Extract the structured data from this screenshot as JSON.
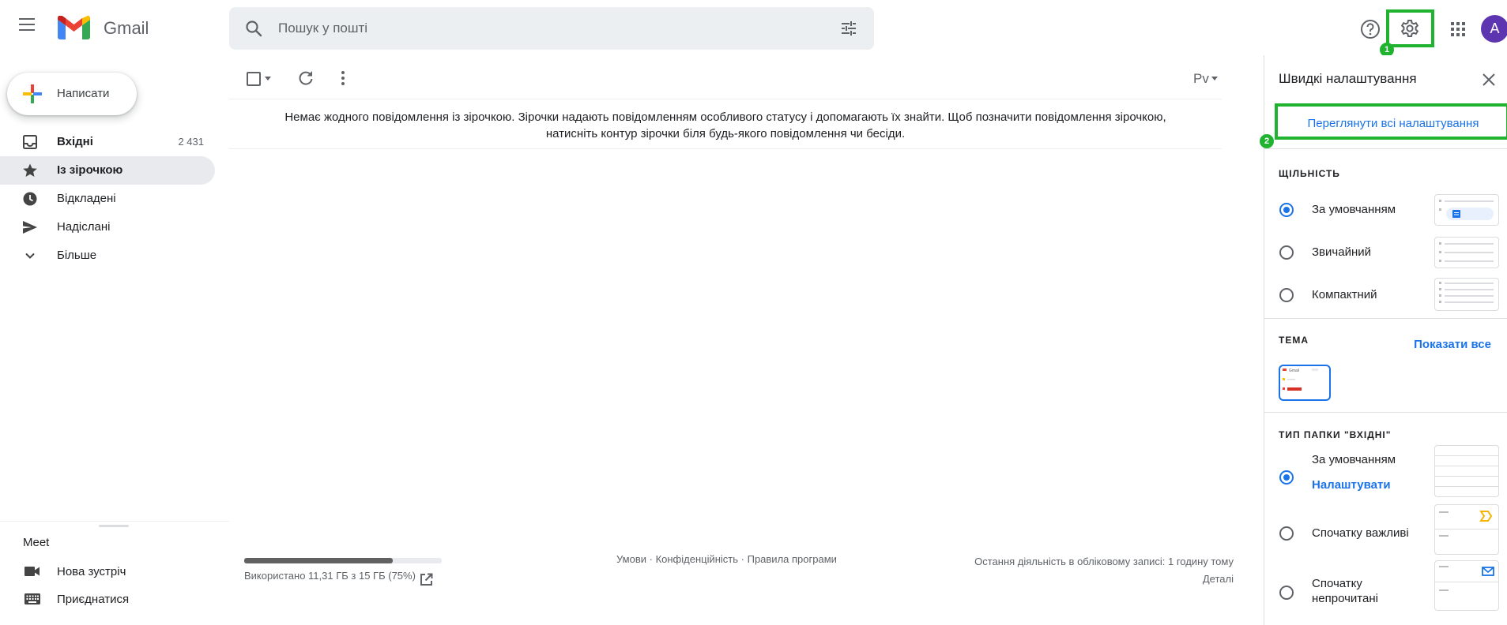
{
  "app": {
    "name": "Gmail"
  },
  "header": {
    "search_placeholder": "Пошук у пошті",
    "avatar_letter": "A",
    "annotations": {
      "step1": "1",
      "step2": "2"
    },
    "colors": {
      "avatar": "#5e35b1",
      "highlight": "#20b330"
    }
  },
  "sidebar": {
    "compose_label": "Написати",
    "items": [
      {
        "label": "Вхідні",
        "count": "2 431",
        "icon": "inbox-icon"
      },
      {
        "label": "Із зірочкою",
        "count": "",
        "icon": "star-icon"
      },
      {
        "label": "Відкладені",
        "count": "",
        "icon": "clock-icon"
      },
      {
        "label": "Надіслані",
        "count": "",
        "icon": "send-icon"
      },
      {
        "label": "Більше",
        "count": "",
        "icon": "chevron-down-icon"
      }
    ],
    "meet": {
      "title": "Meet",
      "new_meeting": "Нова зустріч",
      "join": "Приєднатися"
    }
  },
  "main": {
    "lang_indicator": "Рv",
    "empty_message_line1": "Немає жодного повідомлення із зірочкою. Зірочки надають повідомленням особливого статусу і допомагають їх знайти. Щоб позначити повідомлення зірочкою,",
    "empty_message_line2": "натисніть контур зірочки біля будь-якого повідомлення чи бесіди.",
    "footer": {
      "storage_text": "Використано 11,31 ГБ з 15 ГБ (75%)",
      "storage_fraction": 0.75,
      "terms": "Умови",
      "privacy": "Конфіденційність",
      "policies": "Правила програми",
      "separator": " · ",
      "last_activity": "Остання діяльність в обліковому записі: 1 годину тому",
      "details": "Деталі"
    }
  },
  "quick_settings": {
    "title": "Швидкі налаштування",
    "see_all": "Переглянути всі налаштування",
    "density": {
      "title": "ЩІЛЬНІСТЬ",
      "options": [
        "За умовчанням",
        "Звичайний",
        "Компактний"
      ],
      "selected": 0
    },
    "theme": {
      "title": "ТЕМА",
      "show_all": "Показати все",
      "thumb_logo": "Gmail"
    },
    "inbox_type": {
      "title": "ТИП ПАПКИ \"ВХІДНІ\"",
      "options": [
        "За умовчанням",
        "Спочатку важливі",
        "Спочатку непрочитані"
      ],
      "configure": "Налаштувати",
      "selected": 0
    }
  }
}
